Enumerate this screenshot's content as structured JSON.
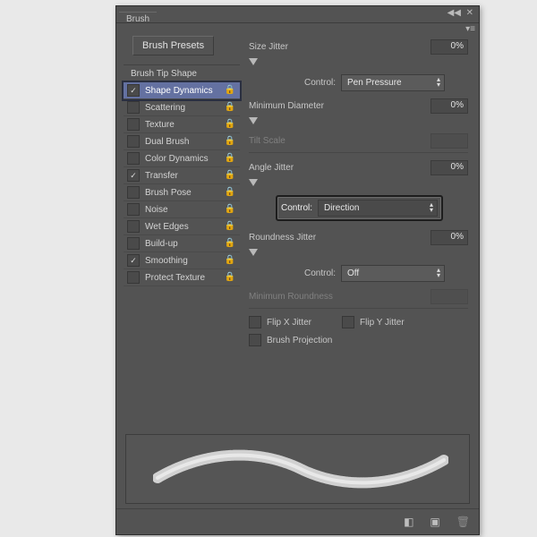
{
  "panel": {
    "title": "Brush"
  },
  "sidebar": {
    "presets_btn": "Brush Presets",
    "tip_shape": "Brush Tip Shape",
    "rows": [
      {
        "label": "Shape Dynamics",
        "checked": true,
        "selected": true
      },
      {
        "label": "Scattering",
        "checked": false
      },
      {
        "label": "Texture",
        "checked": false
      },
      {
        "label": "Dual Brush",
        "checked": false
      },
      {
        "label": "Color Dynamics",
        "checked": false
      },
      {
        "label": "Transfer",
        "checked": true
      },
      {
        "label": "Brush Pose",
        "checked": false
      },
      {
        "label": "Noise",
        "checked": false
      },
      {
        "label": "Wet Edges",
        "checked": false
      },
      {
        "label": "Build-up",
        "checked": false
      },
      {
        "label": "Smoothing",
        "checked": true
      },
      {
        "label": "Protect Texture",
        "checked": false
      }
    ]
  },
  "main": {
    "size_jitter": {
      "label": "Size Jitter",
      "value": "0%"
    },
    "size_control": {
      "label": "Control:",
      "value": "Pen Pressure"
    },
    "min_diameter": {
      "label": "Minimum Diameter",
      "value": "0%"
    },
    "tilt_scale": {
      "label": "Tilt Scale"
    },
    "angle_jitter": {
      "label": "Angle Jitter",
      "value": "0%"
    },
    "angle_control": {
      "label": "Control:",
      "value": "Direction"
    },
    "round_jitter": {
      "label": "Roundness Jitter",
      "value": "0%"
    },
    "round_control": {
      "label": "Control:",
      "value": "Off"
    },
    "min_round": {
      "label": "Minimum Roundness"
    },
    "flipx": "Flip X Jitter",
    "flipy": "Flip Y Jitter",
    "brush_proj": "Brush Projection"
  }
}
